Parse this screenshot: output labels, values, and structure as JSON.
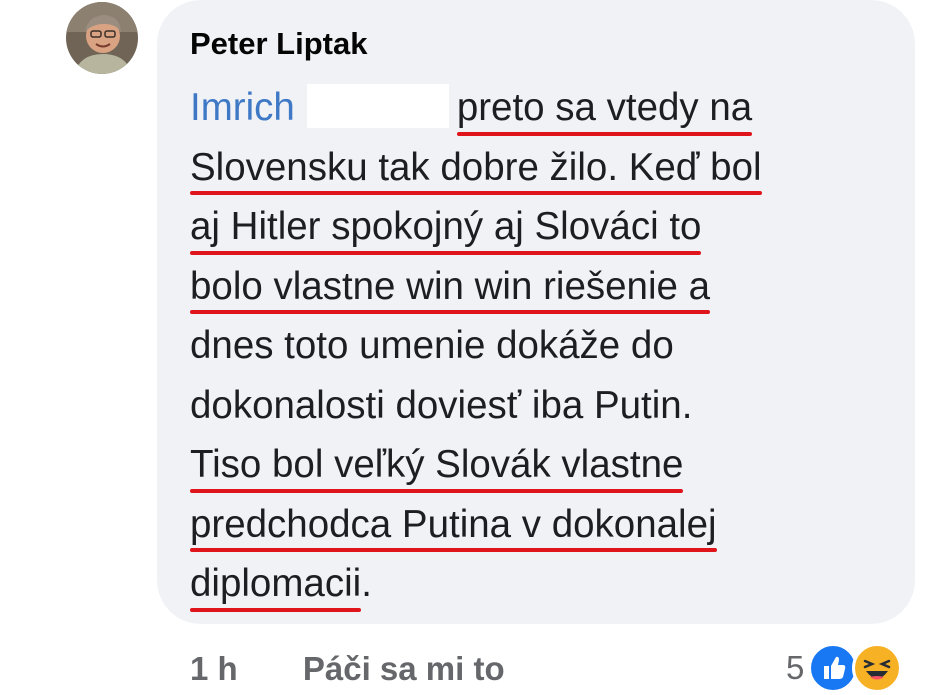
{
  "comment": {
    "author": "Peter Liptak",
    "mention": "Imrich",
    "lines": [
      [
        {
          "t": " preto sa vtedy na",
          "u": true
        }
      ],
      [
        {
          "t": "Slovensku tak dobre žilo. Keď bol",
          "u": true
        }
      ],
      [
        {
          "t": "aj Hitler spokojný aj Slováci to",
          "u": true
        }
      ],
      [
        {
          "t": "bolo vlastne win win riešenie a",
          "u": true
        }
      ],
      [
        {
          "t": "dnes toto umenie dokáže do",
          "u": false
        }
      ],
      [
        {
          "t": "dokonalosti doviesť iba Putin.",
          "u": false
        }
      ],
      [
        {
          "t": "Tiso bol veľký Slovák  vlastne",
          "u": true
        }
      ],
      [
        {
          "t": "predchodca Putina v dokonalej",
          "u": true
        }
      ],
      [
        {
          "t": "diplomacii",
          "u": true
        },
        {
          "t": ".",
          "u": false
        }
      ]
    ]
  },
  "footer": {
    "time": "1 h",
    "like_label": "Páči sa mi to",
    "reaction_count": "5"
  },
  "icons": {
    "avatar": "avatar",
    "like_reaction": "thumbs-up-icon",
    "haha_reaction": "laughing-face-icon"
  },
  "colors": {
    "bubble": "#f0f2f5",
    "mention": "#3f79c6",
    "underline": "#e0151c",
    "like": "#1877f2",
    "haha": "#f7b125"
  }
}
